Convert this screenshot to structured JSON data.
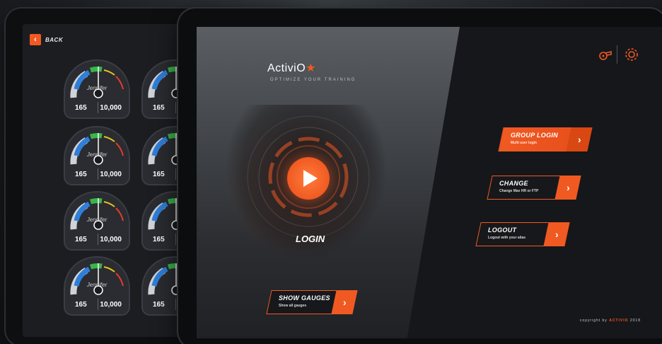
{
  "back_screen": {
    "back_label": "BACK",
    "gauges": [
      {
        "name": "Jennifer",
        "left_value": "165",
        "right_value": "10,000"
      },
      {
        "name": "Jennifer",
        "left_value": "165",
        "right_value": "10,000"
      },
      {
        "name": "Jennifer",
        "left_value": "165",
        "right_value": "10,000"
      },
      {
        "name": "Jennifer",
        "left_value": "165",
        "right_value": "10,000"
      },
      {
        "name": "",
        "left_value": "165",
        "right_value": ""
      },
      {
        "name": "",
        "left_value": "165",
        "right_value": ""
      },
      {
        "name": "",
        "left_value": "165",
        "right_value": ""
      },
      {
        "name": "",
        "left_value": "165",
        "right_value": ""
      }
    ]
  },
  "login_screen": {
    "logo_text": "ActiviO",
    "tagline": "OPTIMIZE YOUR TRAINING",
    "login_label": "LOGIN",
    "show_gauges": {
      "title": "SHOW GAUGES",
      "subtitle": "Show all gauges"
    },
    "group_login": {
      "title": "GROUP LOGIN",
      "subtitle": "Multi user login"
    },
    "change": {
      "title": "CHANGE",
      "subtitle": "Change Max HR or FTP"
    },
    "logout": {
      "title": "LOGOUT",
      "subtitle": "Logout with your alias"
    },
    "copyright_prefix": "copyright by",
    "copyright_brand": "ACTIVIO",
    "copyright_year": "2018",
    "icons": {
      "whistle": "whistle-icon",
      "settings": "gear-icon"
    }
  },
  "colors": {
    "accent": "#f05a22",
    "blue_zone": "#2f7ed8",
    "green_zone": "#3ab54a",
    "yellow_zone": "#e8c21a",
    "red_zone": "#e23b2e"
  }
}
